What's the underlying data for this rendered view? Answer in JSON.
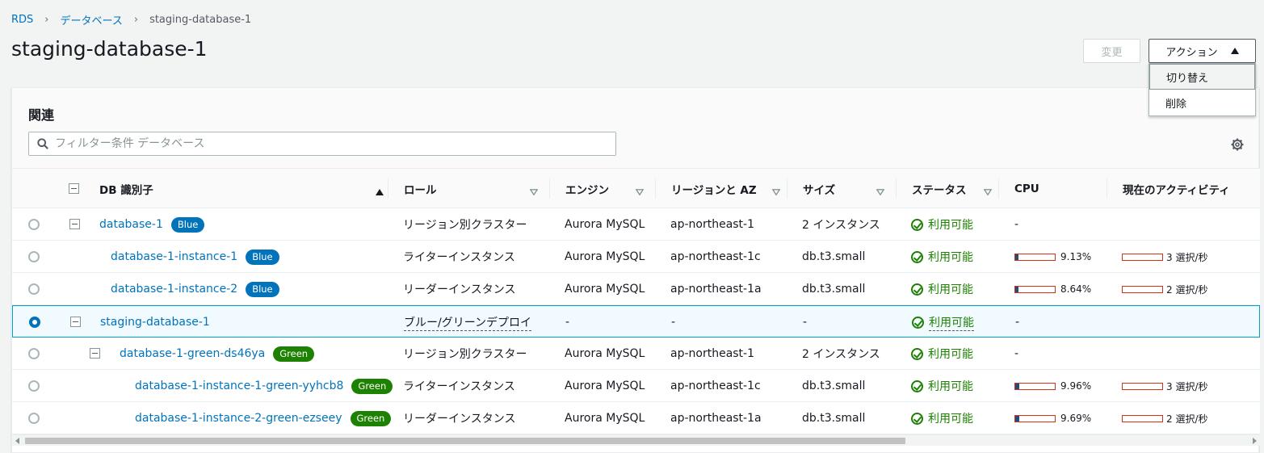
{
  "breadcrumb": {
    "root": "RDS",
    "level2": "データベース",
    "current": "staging-database-1"
  },
  "page_title": "staging-database-1",
  "buttons": {
    "change": "変更",
    "actions": "アクション"
  },
  "actions_menu": {
    "items": [
      "切り替え",
      "削除"
    ]
  },
  "panel": {
    "title": "関連",
    "filter_placeholder": "フィルター条件 データベース"
  },
  "columns": [
    "DB 識別子",
    "ロール",
    "エンジン",
    "リージョンと AZ",
    "サイズ",
    "ステータス",
    "CPU",
    "現在のアクティビティ"
  ],
  "rows": [
    {
      "id": "database-1",
      "badge": "Blue",
      "role": "リージョン別クラスター",
      "engine": "Aurora MySQL",
      "region": "ap-northeast-1",
      "size": "2 インスタンス",
      "status": "利用可能",
      "cpu": "-",
      "activity": ""
    },
    {
      "id": "database-1-instance-1",
      "badge": "Blue",
      "role": "ライターインスタンス",
      "engine": "Aurora MySQL",
      "region": "ap-northeast-1c",
      "size": "db.t3.small",
      "status": "利用可能",
      "cpu": "9.13%",
      "cpu_value": 9.13,
      "activity": "3 選択/秒"
    },
    {
      "id": "database-1-instance-2",
      "badge": "Blue",
      "role": "リーダーインスタンス",
      "engine": "Aurora MySQL",
      "region": "ap-northeast-1a",
      "size": "db.t3.small",
      "status": "利用可能",
      "cpu": "8.64%",
      "cpu_value": 8.64,
      "activity": "2 選択/秒"
    },
    {
      "id": "staging-database-1",
      "badge": "",
      "role": "ブルー/グリーンデプロイ",
      "engine": "-",
      "region": "-",
      "size": "-",
      "status": "利用可能",
      "cpu": "-",
      "activity": ""
    },
    {
      "id": "database-1-green-ds46ya",
      "badge": "Green",
      "role": "リージョン別クラスター",
      "engine": "Aurora MySQL",
      "region": "ap-northeast-1",
      "size": "2 インスタンス",
      "status": "利用可能",
      "cpu": "-",
      "activity": ""
    },
    {
      "id": "database-1-instance-1-green-yyhcb8",
      "badge": "Green",
      "role": "ライターインスタンス",
      "engine": "Aurora MySQL",
      "region": "ap-northeast-1c",
      "size": "db.t3.small",
      "status": "利用可能",
      "cpu": "9.96%",
      "cpu_value": 9.96,
      "activity": "3 選択/秒"
    },
    {
      "id": "database-1-instance-2-green-ezseey",
      "badge": "Green",
      "role": "リーダーインスタンス",
      "engine": "Aurora MySQL",
      "region": "ap-northeast-1a",
      "size": "db.t3.small",
      "status": "利用可能",
      "cpu": "9.69%",
      "cpu_value": 9.69,
      "activity": "2 選択/秒"
    }
  ],
  "selected_row": "staging-database-1",
  "colors": {
    "link": "#0073bb",
    "blue_badge": "#0073bb",
    "green_badge": "#1d8102",
    "status_ok": "#1d8102",
    "selected_border": "#00a1c9"
  },
  "icons": {
    "filter": "search-icon",
    "settings": "gear-icon",
    "status": "check-circle-icon"
  }
}
